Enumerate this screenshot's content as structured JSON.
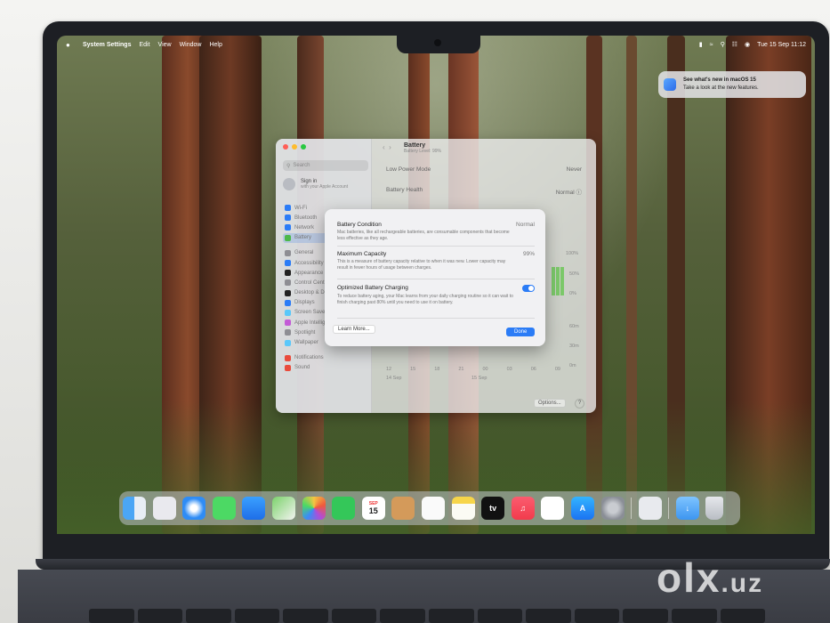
{
  "menubar": {
    "app_name": "System Settings",
    "menus": [
      "Edit",
      "View",
      "Window",
      "Help"
    ],
    "clock": "Tue 15 Sep  11:12"
  },
  "notification": {
    "title": "See what's new in macOS 15",
    "body": "Take a look at the new features."
  },
  "settings": {
    "search_placeholder": "Search",
    "signin": {
      "title": "Sign in",
      "subtitle": "with your Apple Account"
    },
    "sidebar_items": [
      {
        "label": "Wi-Fi",
        "color": "#2b7cf6"
      },
      {
        "label": "Bluetooth",
        "color": "#2b7cf6"
      },
      {
        "label": "Network",
        "color": "#2b7cf6"
      },
      {
        "label": "Battery",
        "color": "#4cb84a",
        "selected": true
      },
      {
        "label": "General",
        "color": "#8e8e93"
      },
      {
        "label": "Accessibility",
        "color": "#2b7cf6"
      },
      {
        "label": "Appearance",
        "color": "#222222"
      },
      {
        "label": "Control Centre",
        "color": "#8e8e93"
      },
      {
        "label": "Desktop & Dock",
        "color": "#222222"
      },
      {
        "label": "Displays",
        "color": "#2b7cf6"
      },
      {
        "label": "Screen Saver",
        "color": "#5ac8fa"
      },
      {
        "label": "Apple Intelligence & Siri",
        "color": "#c35bd6"
      },
      {
        "label": "Spotlight",
        "color": "#8e8e93"
      },
      {
        "label": "Wallpaper",
        "color": "#5ac8fa"
      },
      {
        "label": "Notifications",
        "color": "#e94b3c"
      },
      {
        "label": "Sound",
        "color": "#e94b3c"
      }
    ],
    "pane": {
      "title": "Battery",
      "subtitle": "Battery Level: 99%",
      "low_power_label": "Low Power Mode",
      "low_power_value": "Never",
      "health_label": "Battery Health",
      "health_value": "Normal",
      "level_axis": [
        "100%",
        "50%",
        "0%"
      ],
      "usage_axis": [
        "60m",
        "30m",
        "0m"
      ],
      "time_ticks": [
        "12",
        "15",
        "18",
        "21",
        "00",
        "03",
        "06",
        "09"
      ],
      "dates": [
        "14 Sep",
        "15 Sep"
      ],
      "options_label": "Options...",
      "help_label": "?"
    }
  },
  "sheet": {
    "condition_title": "Battery Condition",
    "condition_value": "Normal",
    "condition_desc": "Mac batteries, like all rechargeable batteries, are consumable components that become less effective as they age.",
    "capacity_title": "Maximum Capacity",
    "capacity_value": "99%",
    "capacity_desc": "This is a measure of battery capacity relative to when it was new. Lower capacity may result in fewer hours of usage between charges.",
    "optimized_title": "Optimized Battery Charging",
    "optimized_desc": "To reduce battery aging, your Mac learns from your daily charging routine so it can wait to finish charging past 80% until you need to use it on battery.",
    "optimized_on": true,
    "learn_more": "Learn More...",
    "done": "Done"
  },
  "dock": {
    "calendar_month": "SEP",
    "calendar_day": "15",
    "apps": [
      "finder-icon",
      "launchpad-icon",
      "safari-icon",
      "messages-icon",
      "mail-icon",
      "maps-icon",
      "photos-icon",
      "facetime-icon",
      "calendar-icon",
      "contacts-icon",
      "reminders-icon",
      "notes-icon",
      "tv-icon",
      "music-icon",
      "freeform-icon",
      "app-store-icon",
      "system-settings-icon",
      "preview-icon",
      "downloads-icon",
      "trash-icon"
    ],
    "tv_label": "tv"
  },
  "watermark": {
    "brand": "olx",
    "suffix": ".uz"
  }
}
